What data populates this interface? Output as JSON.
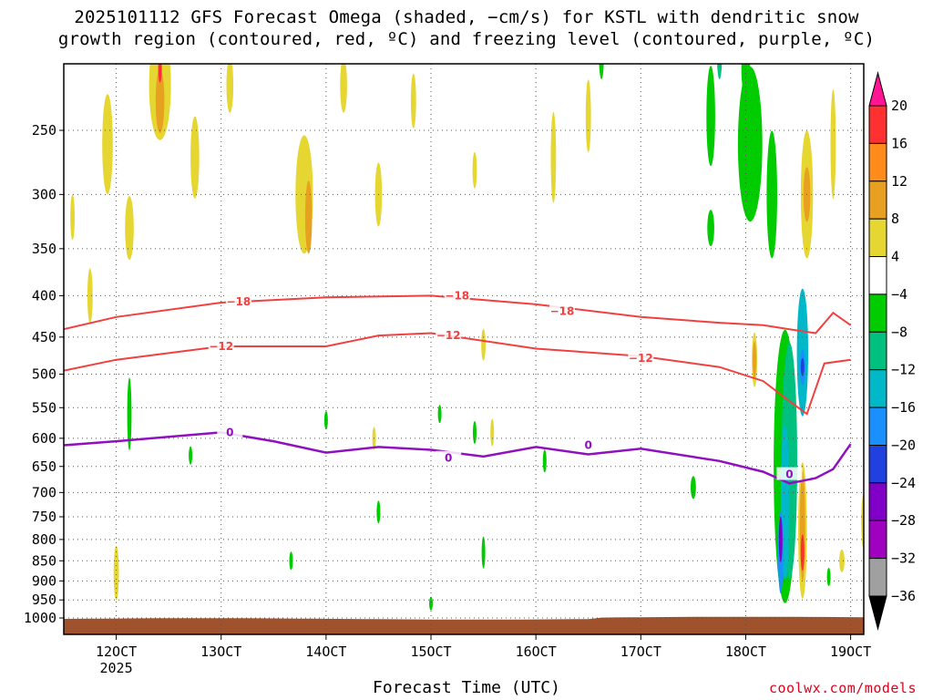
{
  "title_line1": "2025101112 GFS Forecast Omega (shaded, −cm/s) for KSTL with dendritic snow",
  "title_line2": "growth region (contoured, red, ºC) and freezing level (contoured, purple, ºC)",
  "credit": "coolwx.com/models",
  "chart_data": {
    "type": "heatmap",
    "title": "2025101112 GFS Forecast Omega (shaded, −cm/s) for KSTL with dendritic snow growth region (contoured, red, ºC) and freezing level (contoured, purple, ºC)",
    "xlabel": "Forecast Time (UTC)",
    "ylabel": "",
    "x_range": [
      "11/15Z",
      "19/00Z"
    ],
    "x_ticks": [
      "12OCT",
      "13OCT",
      "14OCT",
      "15OCT",
      "16OCT",
      "17OCT",
      "18OCT",
      "19OCT"
    ],
    "x_tick_values_hours": [
      12,
      36,
      60,
      84,
      108,
      132,
      156,
      180
    ],
    "x_year_label": "2025",
    "y_scale": "log-pressure",
    "y_range_hpa": [
      1000,
      200
    ],
    "y_ticks": [
      250,
      300,
      350,
      400,
      450,
      500,
      550,
      600,
      650,
      700,
      750,
      800,
      850,
      900,
      950,
      1000
    ],
    "grid": true,
    "colorbar": {
      "labels": [
        "20",
        "16",
        "12",
        "8",
        "4",
        "−4",
        "−8",
        "−12",
        "−16",
        "−20",
        "−24",
        "−28",
        "−32",
        "−36"
      ],
      "levels": [
        20,
        16,
        12,
        8,
        4,
        -4,
        -8,
        -12,
        -16,
        -20,
        -24,
        -28,
        -32,
        -36
      ],
      "colors": [
        "#ff1493",
        "#ff3030",
        "#ff8c1a",
        "#e8a020",
        "#e6d632",
        "#ffffff",
        "#00cc00",
        "#00c080",
        "#00b8c8",
        "#1a90ff",
        "#2040e0",
        "#8000c8",
        "#a000c0",
        "#a0a0a0",
        "#000000"
      ]
    },
    "contours": {
      "dgz_top_label": "−18",
      "dgz_bottom_label": "−12",
      "freezing_label": "0",
      "dgz_color": "#f04040",
      "freezing_color": "#9010c0",
      "level_minus18_hpa": [
        [
          0,
          440
        ],
        [
          12,
          425
        ],
        [
          36,
          408
        ],
        [
          60,
          402
        ],
        [
          84,
          400
        ],
        [
          108,
          410
        ],
        [
          132,
          425
        ],
        [
          150,
          432
        ],
        [
          160,
          435
        ],
        [
          166,
          440
        ],
        [
          172,
          445
        ],
        [
          176,
          420
        ],
        [
          180,
          435
        ]
      ],
      "level_minus12_hpa": [
        [
          0,
          495
        ],
        [
          12,
          480
        ],
        [
          36,
          462
        ],
        [
          60,
          462
        ],
        [
          72,
          448
        ],
        [
          84,
          445
        ],
        [
          108,
          465
        ],
        [
          132,
          475
        ],
        [
          150,
          490
        ],
        [
          160,
          510
        ],
        [
          166,
          540
        ],
        [
          170,
          560
        ],
        [
          174,
          485
        ],
        [
          180,
          480
        ]
      ],
      "level_0_hpa": [
        [
          0,
          612
        ],
        [
          12,
          605
        ],
        [
          36,
          590
        ],
        [
          48,
          605
        ],
        [
          60,
          625
        ],
        [
          72,
          615
        ],
        [
          84,
          620
        ],
        [
          96,
          632
        ],
        [
          108,
          615
        ],
        [
          120,
          628
        ],
        [
          132,
          618
        ],
        [
          150,
          640
        ],
        [
          160,
          660
        ],
        [
          166,
          682
        ],
        [
          172,
          672
        ],
        [
          176,
          655
        ],
        [
          180,
          610
        ]
      ]
    },
    "omega_features": [
      {
        "desc": "strong ascent core",
        "hours": [
          162,
          170
        ],
        "p_hpa": [
          550,
          950
        ],
        "min": -36
      },
      {
        "desc": "descent core",
        "hours": [
          166,
          170
        ],
        "p_hpa": [
          700,
          950
        ],
        "max": 16
      },
      {
        "desc": "upper ascent band",
        "hours": [
          140,
          172
        ],
        "p_hpa": [
          200,
          600
        ],
        "min": -12
      }
    ],
    "terrain_color": "#a0522d"
  }
}
